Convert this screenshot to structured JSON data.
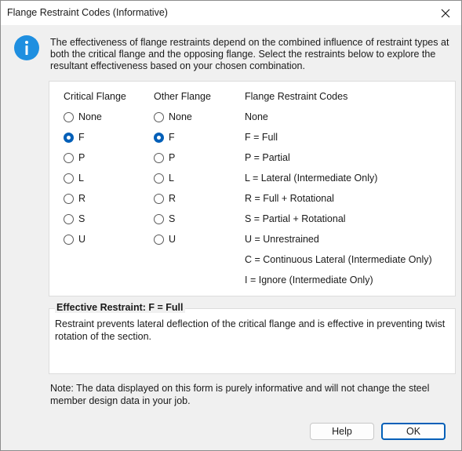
{
  "window": {
    "title": "Flange Restraint Codes (Informative)"
  },
  "intro_text": "The effectiveness of flange restraints depend on the combined influence of restraint types at both the critical flange and the opposing flange. Select the restraints below to explore the resultant effectiveness based on your chosen combination.",
  "columns": {
    "critical_header": "Critical Flange",
    "other_header": "Other Flange",
    "codes_header": "Flange Restraint Codes"
  },
  "critical_options": [
    {
      "label": "None",
      "checked": false
    },
    {
      "label": "F",
      "checked": true
    },
    {
      "label": "P",
      "checked": false
    },
    {
      "label": "L",
      "checked": false
    },
    {
      "label": "R",
      "checked": false
    },
    {
      "label": "S",
      "checked": false
    },
    {
      "label": "U",
      "checked": false
    }
  ],
  "other_options": [
    {
      "label": "None",
      "checked": false
    },
    {
      "label": "F",
      "checked": true
    },
    {
      "label": "P",
      "checked": false
    },
    {
      "label": "L",
      "checked": false
    },
    {
      "label": "R",
      "checked": false
    },
    {
      "label": "S",
      "checked": false
    },
    {
      "label": "U",
      "checked": false
    }
  ],
  "codes": [
    "None",
    "F = Full",
    "P = Partial",
    "L = Lateral (Intermediate Only)",
    "R = Full + Rotational",
    "S = Partial + Rotational",
    "U = Unrestrained",
    "C = Continuous Lateral (Intermediate Only)",
    "I = Ignore (Intermediate Only)"
  ],
  "effective": {
    "legend": "Effective Restraint: F = Full",
    "description": "Restraint prevents lateral deflection of the critical flange and is effective in preventing twist rotation of the section."
  },
  "note": "Note: The data displayed on this form is purely informative and will not change the steel member design data in your job.",
  "buttons": {
    "help": "Help",
    "ok": "OK"
  },
  "colors": {
    "accent": "#005fb8",
    "info_icon": "#1f8fe0"
  }
}
